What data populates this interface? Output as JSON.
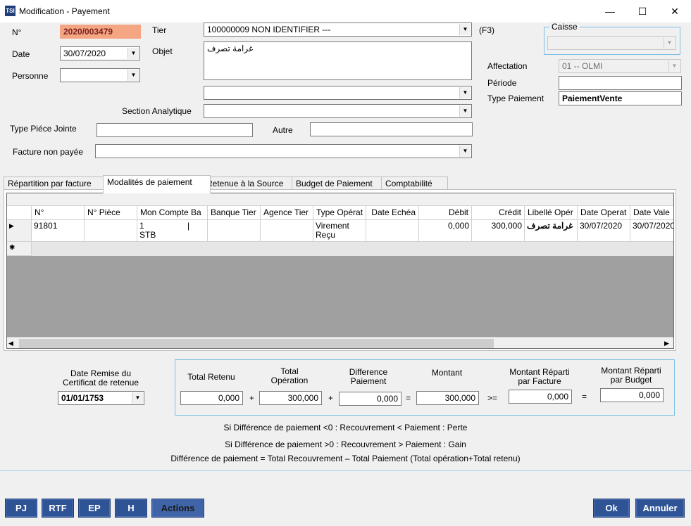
{
  "window": {
    "title": "Modification - Payement",
    "minimize": "—",
    "maximize": "☐",
    "close": "✕"
  },
  "form": {
    "numero_label": "N°",
    "numero_value": "2020/003479",
    "date_label": "Date",
    "date_value": "30/07/2020",
    "personne_label": "Personne",
    "personne_value": "",
    "tier_label": "Tier",
    "tier_value": "100000009 NON IDENTIFIER ---",
    "tier_hint": "(F3)",
    "objet_label": "Objet",
    "objet_value": "غرامة تصرف",
    "combo_blank_value": "",
    "section_label": "Section Analytique",
    "section_value": "",
    "type_piece_label": "Type Piéce Jointe",
    "type_piece_value": "",
    "autre_label": "Autre",
    "autre_value": "",
    "facture_label": "Facture non payée",
    "facture_value": "",
    "caisse_label": "Caisse",
    "caisse_value": "",
    "affectation_label": "Affectation",
    "affectation_value": "01 -- OLMI",
    "periode_label": "Période",
    "periode_value": "",
    "type_paiement_label": "Type Paiement",
    "type_paiement_value": "PaiementVente"
  },
  "tabs": [
    {
      "label": "Répartition par facture"
    },
    {
      "label": "Modalités de paiement"
    },
    {
      "label": "Retenue à la Source"
    },
    {
      "label": "Budget de Paiement"
    },
    {
      "label": "Comptabilité"
    }
  ],
  "grid": {
    "columns": [
      "N°",
      "N° Pièce",
      "Mon Compte Ba",
      "Banque Tier",
      "Agence Tier",
      "Type Opérat",
      "Date Echéa",
      "Débit",
      "Crédit",
      "Libellé Opér",
      "Date Operat",
      "Date Vale"
    ],
    "rows": [
      {
        "numero": "91801",
        "piece": "",
        "compte_line1": "1",
        "compte_line2": "STB",
        "compte_sep": "|",
        "banque": "",
        "agence": "",
        "type_line1": "Virement",
        "type_line2": "Reçu",
        "echeance": "",
        "debit": "0,000",
        "credit": "300,000",
        "libelle": "غرامة تصرف",
        "date_operation": "30/07/2020",
        "date_valeur": "30/07/2020"
      }
    ],
    "new_row_marker": "✱",
    "current_row_marker": "▶"
  },
  "certificat": {
    "label_line1": "Date Remise du",
    "label_line2": "Certificat de retenue",
    "value": "01/01/1753"
  },
  "totals": {
    "total_retenu_label": "Total Retenu",
    "total_retenu_value": "0,000",
    "total_operation_label_line1": "Total",
    "total_operation_label_line2": "Opération",
    "total_operation_value": "300,000",
    "difference_label_line1": "Difference",
    "difference_label_line2": "Paiement",
    "difference_value": "0,000",
    "montant_label": "Montant",
    "montant_value": "300,000",
    "reparti_facture_label_line1": "Montant Réparti",
    "reparti_facture_label_line2": "par Facture",
    "reparti_facture_value": "0,000",
    "reparti_budget_label_line1": "Montant Réparti",
    "reparti_budget_label_line2": "par Budget",
    "reparti_budget_value": "0,000",
    "op_plus": "+",
    "op_equals": "=",
    "op_gte": ">="
  },
  "notes": [
    "Si Différence de paiement <0 : Recouvrement < Paiement : Perte",
    "Si Différence de paiement >0 : Recouvrement > Paiement : Gain",
    "Différence de paiement = Total Recouvrement – Total Paiement (Total opération+Total retenu)"
  ],
  "buttons": {
    "pj": "PJ",
    "rtf": "RTF",
    "ep": "EP",
    "h": "H",
    "actions": "Actions",
    "ok": "Ok",
    "annuler": "Annuler"
  },
  "colors": {
    "accent_button": "#2f5496",
    "highlight_field": "#f4a582",
    "panel_border": "#7ec0e5"
  }
}
